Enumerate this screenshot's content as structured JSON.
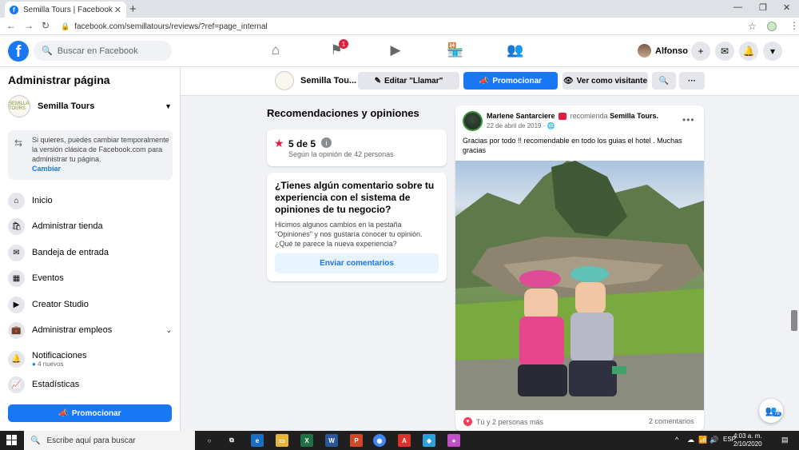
{
  "browser": {
    "tab_title": "Semilla Tours | Facebook",
    "tab_favicon": "f",
    "url": "facebook.com/semillatours/reviews/?ref=page_internal"
  },
  "fbnav": {
    "logo": "f",
    "search_placeholder": "Buscar en Facebook",
    "notif_badge": "1",
    "user_name": "Alfonso"
  },
  "sidebar": {
    "title": "Administrar página",
    "page_name": "Semilla Tours",
    "page_logo_text": "SEMILLA TOURS",
    "info_text": "Si quieres, puedes cambiar temporalmente la versión clásica de Facebook.com para administrar tu página.",
    "info_link": "Cambiar",
    "items": [
      {
        "label": "Inicio",
        "icon": "home-icon"
      },
      {
        "label": "Administrar tienda",
        "icon": "shop-bag-icon"
      },
      {
        "label": "Bandeja de entrada",
        "icon": "inbox-icon"
      },
      {
        "label": "Eventos",
        "icon": "calendar-icon"
      },
      {
        "label": "Creator Studio",
        "icon": "video-icon"
      },
      {
        "label": "Administrar empleos",
        "icon": "briefcase-icon"
      },
      {
        "label": "Notificaciones",
        "icon": "bell-icon",
        "sub": "4 nuevos"
      },
      {
        "label": "Estadísticas",
        "icon": "chart-icon"
      }
    ],
    "promote_label": "Promocionar"
  },
  "pagebar": {
    "page_name": "Semilla Tou...",
    "edit_call": "Editar \"Llamar\"",
    "promote": "Promocionar",
    "view_as": "Ver como visitante"
  },
  "reviews": {
    "section_title": "Recomendaciones y opiniones",
    "score": "5 de 5",
    "based_on": "Según la opinión de 42 personas",
    "feedback_question": "¿Tienes algún comentario sobre tu experiencia con el sistema de opiniones de tu negocio?",
    "feedback_desc": "Hicimos algunos cambios en la pestaña \"Opiniones\" y nos gustaría conocer tu opinión. ¿Qué te parece la nueva experiencia?",
    "send_feedback": "Enviar comentarios"
  },
  "post": {
    "author": "Marlene Santarciere",
    "action": "recomienda",
    "target": "Semilla Tours.",
    "date": "22 de abril de 2019 · ",
    "text": "Gracias por todo !! recomendable en todo los guias el hotel . Muchas gracias",
    "reactions": "Tú y 2 personas más",
    "comments": "2 comentarios"
  },
  "chat_count": "78",
  "taskbar": {
    "search_placeholder": "Escribe aquí para buscar",
    "lang": "ESP",
    "time": "4:03 a. m.",
    "date": "2/10/2020"
  },
  "colors": {
    "fb_blue": "#1877f2",
    "background": "#f0f2f5",
    "badge_red": "#e41e3f"
  }
}
